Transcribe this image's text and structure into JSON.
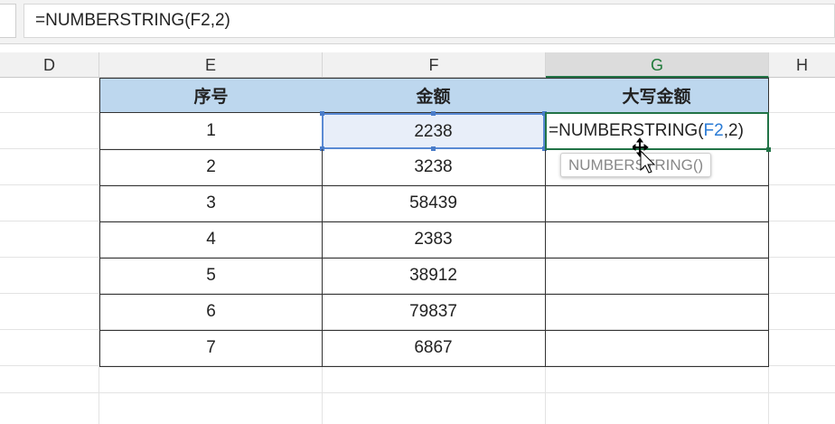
{
  "formula_bar": {
    "value": "=NUMBERSTRING(F2,2)"
  },
  "columns": [
    "D",
    "E",
    "F",
    "G",
    "H"
  ],
  "table": {
    "headers": [
      "序号",
      "金额",
      "大写金额"
    ],
    "rows": [
      [
        "1",
        "2238",
        ""
      ],
      [
        "2",
        "3238",
        ""
      ],
      [
        "3",
        "58439",
        ""
      ],
      [
        "4",
        "2383",
        ""
      ],
      [
        "5",
        "38912",
        ""
      ],
      [
        "6",
        "79837",
        ""
      ],
      [
        "7",
        "6867",
        ""
      ]
    ]
  },
  "editing_cell": {
    "prefix": "=NUMBERSTRING(",
    "ref": "F2",
    "suffix": ",2)"
  },
  "tooltip": {
    "text": "NUMBERSTRING()"
  },
  "colors": {
    "header_fill": "#bdd7ee",
    "selection_green": "#217346",
    "ref_blue": "#2a7bd5"
  }
}
